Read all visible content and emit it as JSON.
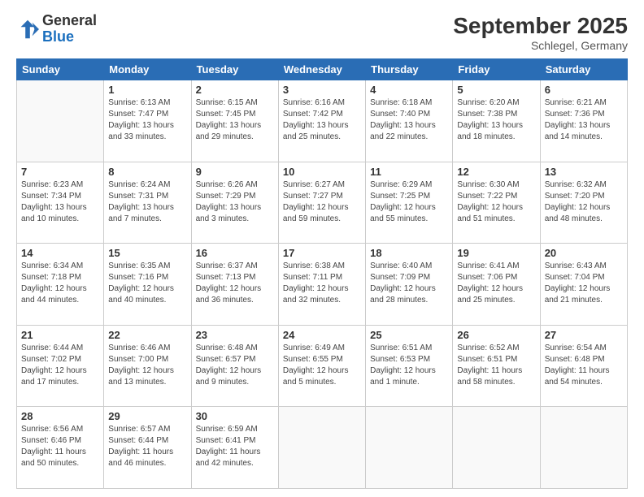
{
  "header": {
    "logo_general": "General",
    "logo_blue": "Blue",
    "month_title": "September 2025",
    "subtitle": "Schlegel, Germany"
  },
  "weekdays": [
    "Sunday",
    "Monday",
    "Tuesday",
    "Wednesday",
    "Thursday",
    "Friday",
    "Saturday"
  ],
  "weeks": [
    [
      {
        "day": "",
        "info": ""
      },
      {
        "day": "1",
        "info": "Sunrise: 6:13 AM\nSunset: 7:47 PM\nDaylight: 13 hours\nand 33 minutes."
      },
      {
        "day": "2",
        "info": "Sunrise: 6:15 AM\nSunset: 7:45 PM\nDaylight: 13 hours\nand 29 minutes."
      },
      {
        "day": "3",
        "info": "Sunrise: 6:16 AM\nSunset: 7:42 PM\nDaylight: 13 hours\nand 25 minutes."
      },
      {
        "day": "4",
        "info": "Sunrise: 6:18 AM\nSunset: 7:40 PM\nDaylight: 13 hours\nand 22 minutes."
      },
      {
        "day": "5",
        "info": "Sunrise: 6:20 AM\nSunset: 7:38 PM\nDaylight: 13 hours\nand 18 minutes."
      },
      {
        "day": "6",
        "info": "Sunrise: 6:21 AM\nSunset: 7:36 PM\nDaylight: 13 hours\nand 14 minutes."
      }
    ],
    [
      {
        "day": "7",
        "info": "Sunrise: 6:23 AM\nSunset: 7:34 PM\nDaylight: 13 hours\nand 10 minutes."
      },
      {
        "day": "8",
        "info": "Sunrise: 6:24 AM\nSunset: 7:31 PM\nDaylight: 13 hours\nand 7 minutes."
      },
      {
        "day": "9",
        "info": "Sunrise: 6:26 AM\nSunset: 7:29 PM\nDaylight: 13 hours\nand 3 minutes."
      },
      {
        "day": "10",
        "info": "Sunrise: 6:27 AM\nSunset: 7:27 PM\nDaylight: 12 hours\nand 59 minutes."
      },
      {
        "day": "11",
        "info": "Sunrise: 6:29 AM\nSunset: 7:25 PM\nDaylight: 12 hours\nand 55 minutes."
      },
      {
        "day": "12",
        "info": "Sunrise: 6:30 AM\nSunset: 7:22 PM\nDaylight: 12 hours\nand 51 minutes."
      },
      {
        "day": "13",
        "info": "Sunrise: 6:32 AM\nSunset: 7:20 PM\nDaylight: 12 hours\nand 48 minutes."
      }
    ],
    [
      {
        "day": "14",
        "info": "Sunrise: 6:34 AM\nSunset: 7:18 PM\nDaylight: 12 hours\nand 44 minutes."
      },
      {
        "day": "15",
        "info": "Sunrise: 6:35 AM\nSunset: 7:16 PM\nDaylight: 12 hours\nand 40 minutes."
      },
      {
        "day": "16",
        "info": "Sunrise: 6:37 AM\nSunset: 7:13 PM\nDaylight: 12 hours\nand 36 minutes."
      },
      {
        "day": "17",
        "info": "Sunrise: 6:38 AM\nSunset: 7:11 PM\nDaylight: 12 hours\nand 32 minutes."
      },
      {
        "day": "18",
        "info": "Sunrise: 6:40 AM\nSunset: 7:09 PM\nDaylight: 12 hours\nand 28 minutes."
      },
      {
        "day": "19",
        "info": "Sunrise: 6:41 AM\nSunset: 7:06 PM\nDaylight: 12 hours\nand 25 minutes."
      },
      {
        "day": "20",
        "info": "Sunrise: 6:43 AM\nSunset: 7:04 PM\nDaylight: 12 hours\nand 21 minutes."
      }
    ],
    [
      {
        "day": "21",
        "info": "Sunrise: 6:44 AM\nSunset: 7:02 PM\nDaylight: 12 hours\nand 17 minutes."
      },
      {
        "day": "22",
        "info": "Sunrise: 6:46 AM\nSunset: 7:00 PM\nDaylight: 12 hours\nand 13 minutes."
      },
      {
        "day": "23",
        "info": "Sunrise: 6:48 AM\nSunset: 6:57 PM\nDaylight: 12 hours\nand 9 minutes."
      },
      {
        "day": "24",
        "info": "Sunrise: 6:49 AM\nSunset: 6:55 PM\nDaylight: 12 hours\nand 5 minutes."
      },
      {
        "day": "25",
        "info": "Sunrise: 6:51 AM\nSunset: 6:53 PM\nDaylight: 12 hours\nand 1 minute."
      },
      {
        "day": "26",
        "info": "Sunrise: 6:52 AM\nSunset: 6:51 PM\nDaylight: 11 hours\nand 58 minutes."
      },
      {
        "day": "27",
        "info": "Sunrise: 6:54 AM\nSunset: 6:48 PM\nDaylight: 11 hours\nand 54 minutes."
      }
    ],
    [
      {
        "day": "28",
        "info": "Sunrise: 6:56 AM\nSunset: 6:46 PM\nDaylight: 11 hours\nand 50 minutes."
      },
      {
        "day": "29",
        "info": "Sunrise: 6:57 AM\nSunset: 6:44 PM\nDaylight: 11 hours\nand 46 minutes."
      },
      {
        "day": "30",
        "info": "Sunrise: 6:59 AM\nSunset: 6:41 PM\nDaylight: 11 hours\nand 42 minutes."
      },
      {
        "day": "",
        "info": ""
      },
      {
        "day": "",
        "info": ""
      },
      {
        "day": "",
        "info": ""
      },
      {
        "day": "",
        "info": ""
      }
    ]
  ]
}
